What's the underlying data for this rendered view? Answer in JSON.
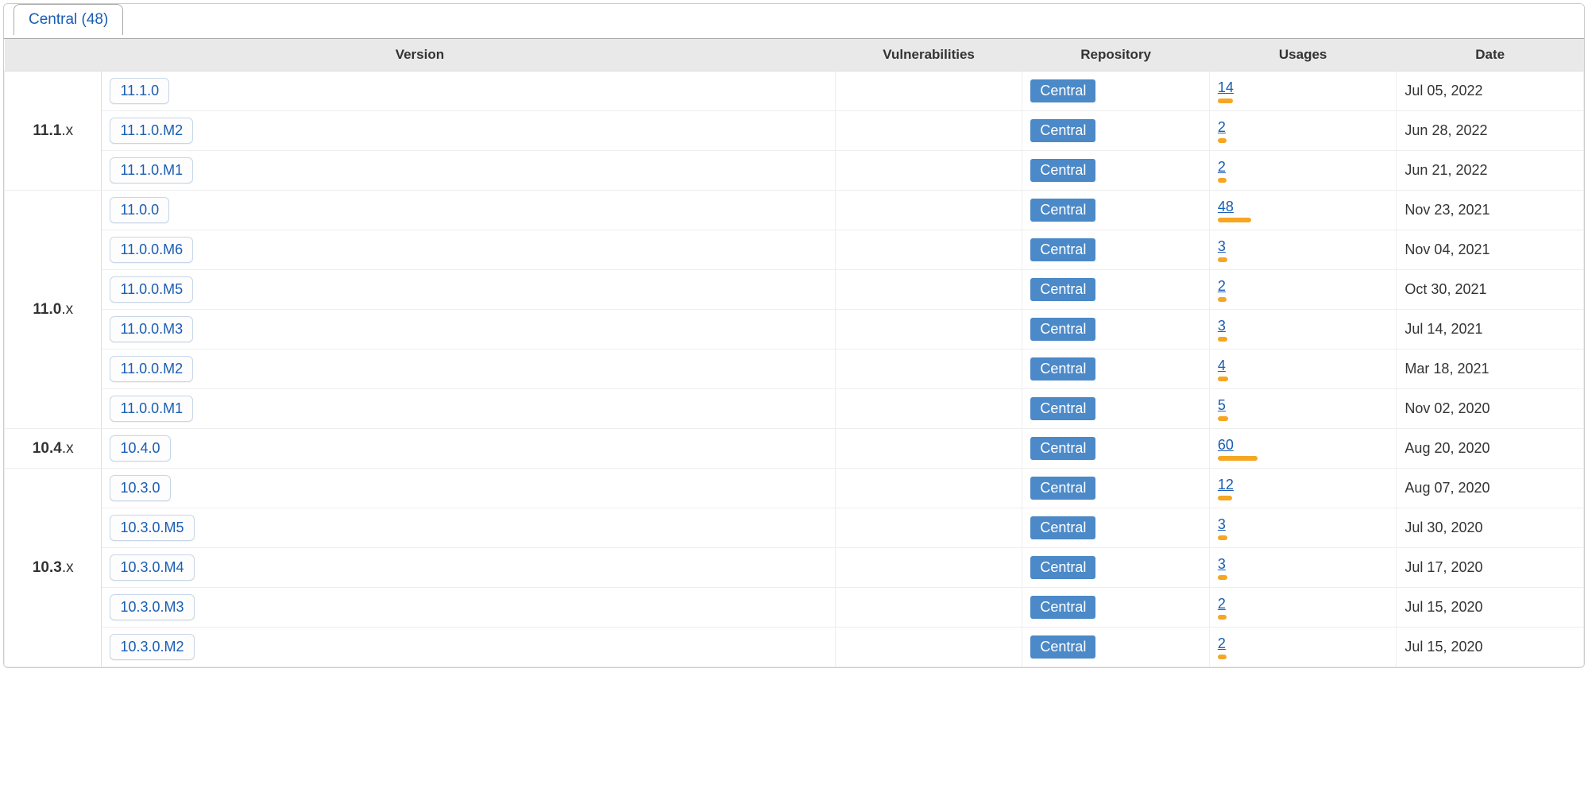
{
  "tab": {
    "label": "Central (48)"
  },
  "columns": {
    "version": "Version",
    "vulnerabilities": "Vulnerabilities",
    "repository": "Repository",
    "usages": "Usages",
    "date": "Date"
  },
  "maxUsages": 60,
  "groups": [
    {
      "prefix_bold": "11.1",
      "prefix_rest": ".x",
      "rows": [
        {
          "version": "11.1.0",
          "vulnerabilities": "",
          "repository": "Central",
          "usages": 14,
          "date": "Jul 05, 2022"
        },
        {
          "version": "11.1.0.M2",
          "vulnerabilities": "",
          "repository": "Central",
          "usages": 2,
          "date": "Jun 28, 2022"
        },
        {
          "version": "11.1.0.M1",
          "vulnerabilities": "",
          "repository": "Central",
          "usages": 2,
          "date": "Jun 21, 2022"
        }
      ]
    },
    {
      "prefix_bold": "11.0",
      "prefix_rest": ".x",
      "rows": [
        {
          "version": "11.0.0",
          "vulnerabilities": "",
          "repository": "Central",
          "usages": 48,
          "date": "Nov 23, 2021"
        },
        {
          "version": "11.0.0.M6",
          "vulnerabilities": "",
          "repository": "Central",
          "usages": 3,
          "date": "Nov 04, 2021"
        },
        {
          "version": "11.0.0.M5",
          "vulnerabilities": "",
          "repository": "Central",
          "usages": 2,
          "date": "Oct 30, 2021"
        },
        {
          "version": "11.0.0.M3",
          "vulnerabilities": "",
          "repository": "Central",
          "usages": 3,
          "date": "Jul 14, 2021"
        },
        {
          "version": "11.0.0.M2",
          "vulnerabilities": "",
          "repository": "Central",
          "usages": 4,
          "date": "Mar 18, 2021"
        },
        {
          "version": "11.0.0.M1",
          "vulnerabilities": "",
          "repository": "Central",
          "usages": 5,
          "date": "Nov 02, 2020"
        }
      ]
    },
    {
      "prefix_bold": "10.4",
      "prefix_rest": ".x",
      "rows": [
        {
          "version": "10.4.0",
          "vulnerabilities": "",
          "repository": "Central",
          "usages": 60,
          "date": "Aug 20, 2020"
        }
      ]
    },
    {
      "prefix_bold": "10.3",
      "prefix_rest": ".x",
      "rows": [
        {
          "version": "10.3.0",
          "vulnerabilities": "",
          "repository": "Central",
          "usages": 12,
          "date": "Aug 07, 2020"
        },
        {
          "version": "10.3.0.M5",
          "vulnerabilities": "",
          "repository": "Central",
          "usages": 3,
          "date": "Jul 30, 2020"
        },
        {
          "version": "10.3.0.M4",
          "vulnerabilities": "",
          "repository": "Central",
          "usages": 3,
          "date": "Jul 17, 2020"
        },
        {
          "version": "10.3.0.M3",
          "vulnerabilities": "",
          "repository": "Central",
          "usages": 2,
          "date": "Jul 15, 2020"
        },
        {
          "version": "10.3.0.M2",
          "vulnerabilities": "",
          "repository": "Central",
          "usages": 2,
          "date": "Jul 15, 2020"
        }
      ]
    }
  ]
}
